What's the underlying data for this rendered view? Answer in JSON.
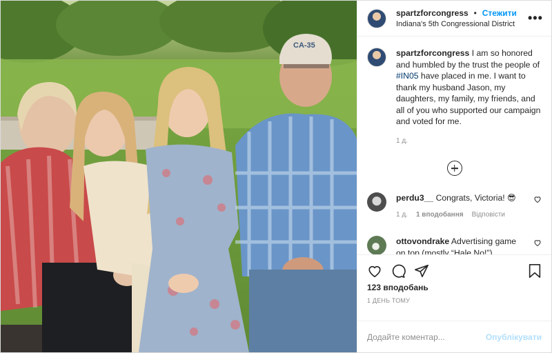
{
  "post": {
    "username": "spartzforcongress",
    "follow_label": "Стежити",
    "location": "Indiana's 5th Congressional District",
    "more_glyph": "•••",
    "caption": {
      "username": "spartzforcongress",
      "text_before": " I am so honored and humbled by the trust the people of ",
      "hashtag": "#IN05",
      "text_after": " have placed in me. I want to thank my husband Jason, my daughters, my family, my friends, and all of you who supported our campaign and voted for me.",
      "age": "1 д."
    },
    "comments": [
      {
        "username": "perdu3__",
        "text": " Congrats, Victoria! 😎",
        "age": "1 д.",
        "likes": "1 вподобання",
        "reply": "Відповісти"
      },
      {
        "username": "ottovondrake",
        "text": " Advertising game on top (mostly “Hale No!”)",
        "age": "",
        "likes": "",
        "reply": ""
      }
    ],
    "like_count": "123 вподобань",
    "date": "1 ДЕНЬ ТОМУ",
    "comment_placeholder": "Додайте коментар...",
    "publish_label": "Опублікувати"
  },
  "colors": {
    "accent": "#0095f6",
    "publish_disabled": "#b2dffc",
    "secondary_text": "#8e8e8e"
  },
  "photo_cap_text": "CA-35"
}
